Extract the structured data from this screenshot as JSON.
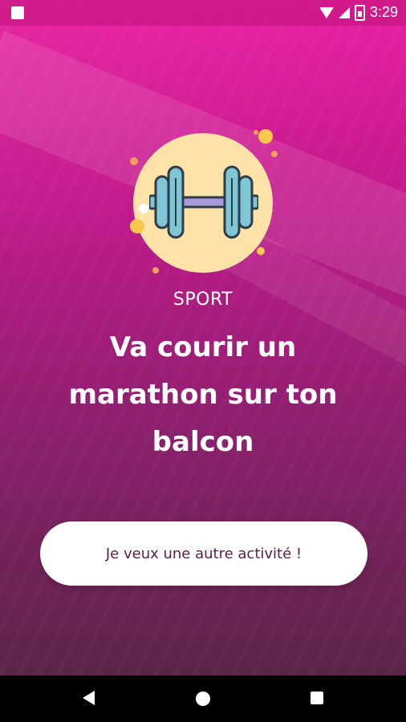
{
  "status_bar": {
    "time": "3:29"
  },
  "activity": {
    "category": "SPORT",
    "title": "Va courir un marathon sur ton balcon",
    "icon": "dumbbell-icon"
  },
  "cta": {
    "label": "Je veux une autre activité !"
  },
  "nav": {
    "back": "back-icon",
    "home": "home-icon",
    "recents": "recents-icon"
  },
  "colors": {
    "gradient_top": "#e71a9e",
    "gradient_bottom": "#5a2547",
    "badge_bg": "#fde3a7",
    "button_text": "#5a1f43"
  }
}
